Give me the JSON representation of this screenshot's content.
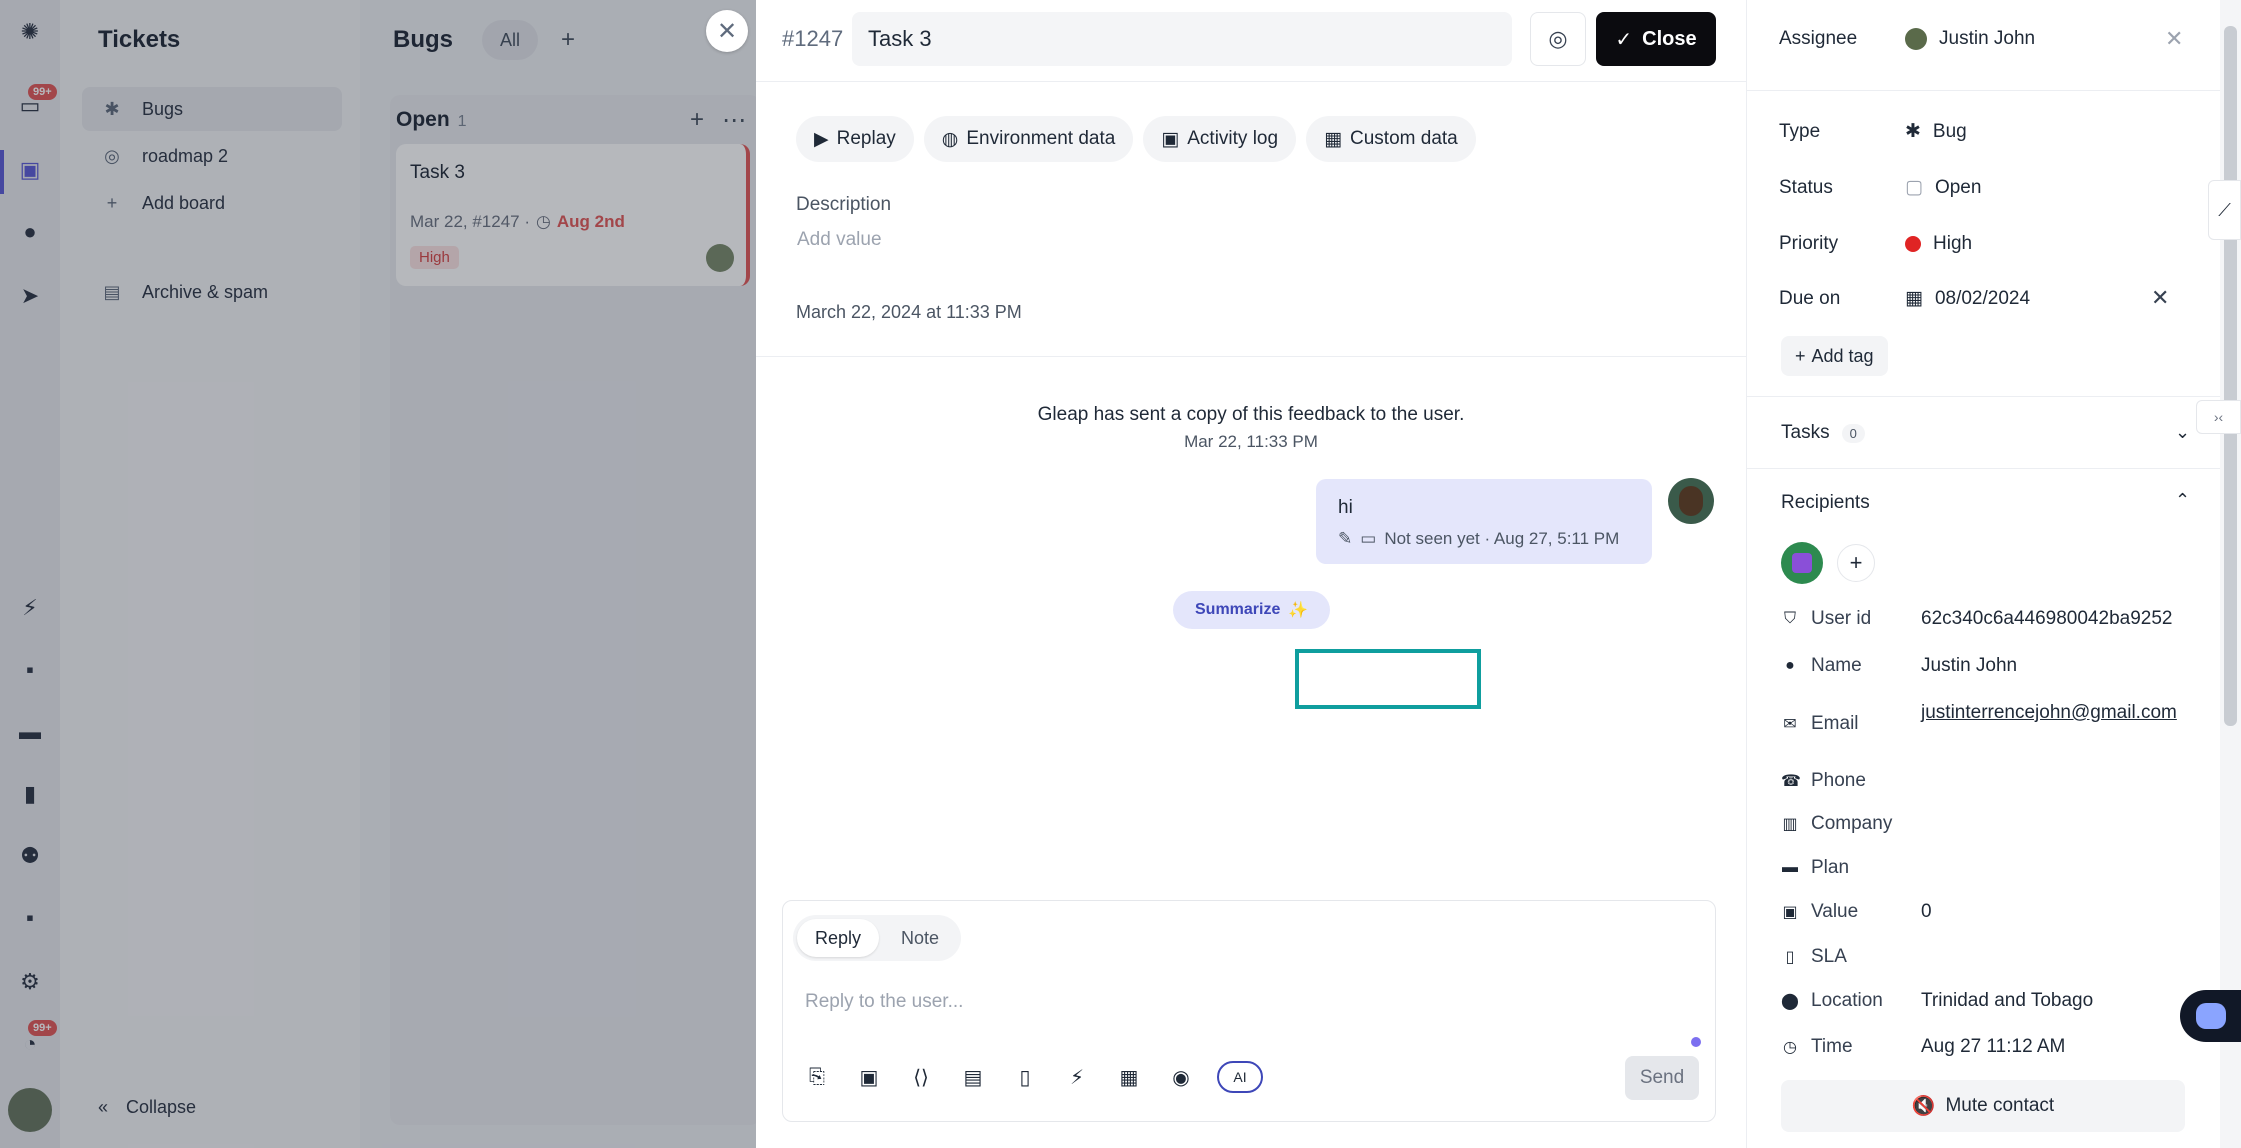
{
  "rail": {
    "badge_top": "99+",
    "badge_bottom": "99+",
    "icons": [
      "logo-icon",
      "inbox-icon",
      "board-icon",
      "bulb-icon",
      "send-icon",
      "bolt-icon",
      "chat-icon",
      "book-icon",
      "chart-icon",
      "users-icon",
      "message-icon",
      "gear-icon",
      "bell-icon",
      "avatar"
    ]
  },
  "col2": {
    "title": "Tickets",
    "items": [
      {
        "label": "Bugs",
        "icon": "bug-icon"
      },
      {
        "label": "roadmap 2",
        "icon": "roadmap-icon"
      },
      {
        "label": "Add board",
        "icon": "plus-icon"
      },
      {
        "label": "Archive & spam",
        "icon": "archive-icon"
      }
    ],
    "collapse": "Collapse"
  },
  "board": {
    "title": "Bugs",
    "all": "All",
    "column": {
      "name": "Open",
      "count": "1"
    },
    "card": {
      "title": "Task 3",
      "meta": "Mar 22, #1247 ·",
      "due": "Aug 2nd",
      "priority": "High"
    }
  },
  "panel": {
    "number": "#1247",
    "title": "Task 3",
    "close_label": "Close",
    "tabs": [
      "Replay",
      "Environment data",
      "Activity log",
      "Custom data"
    ],
    "description_label": "Description",
    "description_placeholder": "Add value",
    "created": "March 22, 2024 at 11:33 PM",
    "system_message": "Gleap has sent a copy of this feedback to the user.",
    "system_date": "Mar 22, 11:33 PM",
    "message": {
      "text": "hi",
      "meta": "Not seen yet · Aug 27, 5:11 PM"
    },
    "summarize": "Summarize",
    "composer": {
      "reply": "Reply",
      "note": "Note",
      "placeholder": "Reply to the user...",
      "send": "Send",
      "ai": "AI"
    }
  },
  "sidebar": {
    "assignee_label": "Assignee",
    "assignee": "Justin John",
    "type_label": "Type",
    "type": "Bug",
    "status_label": "Status",
    "status": "Open",
    "priority_label": "Priority",
    "priority": "High",
    "priority_color": "#e02424",
    "due_label": "Due on",
    "due": "08/02/2024",
    "add_tag": "Add tag",
    "tasks_label": "Tasks",
    "tasks_count": "0",
    "recipients_label": "Recipients",
    "info": [
      {
        "key": "User id",
        "value": "62c340c6a446980042ba9252",
        "icon": "shield-icon"
      },
      {
        "key": "Name",
        "value": "Justin John",
        "icon": "person-icon"
      },
      {
        "key": "Email",
        "value": "justinterrencejohn@gmail.com",
        "icon": "mail-icon"
      },
      {
        "key": "Phone",
        "value": "",
        "icon": "phone-icon"
      },
      {
        "key": "Company",
        "value": "",
        "icon": "building-icon"
      },
      {
        "key": "Plan",
        "value": "",
        "icon": "card-icon"
      },
      {
        "key": "Value",
        "value": "0",
        "icon": "money-icon"
      },
      {
        "key": "SLA",
        "value": "",
        "icon": "doc-icon"
      },
      {
        "key": "Location",
        "value": "Trinidad and Tobago",
        "icon": "pin-icon"
      },
      {
        "key": "Time",
        "value": "Aug 27 11:12 AM",
        "icon": "clock-icon"
      }
    ],
    "mute": "Mute contact"
  }
}
